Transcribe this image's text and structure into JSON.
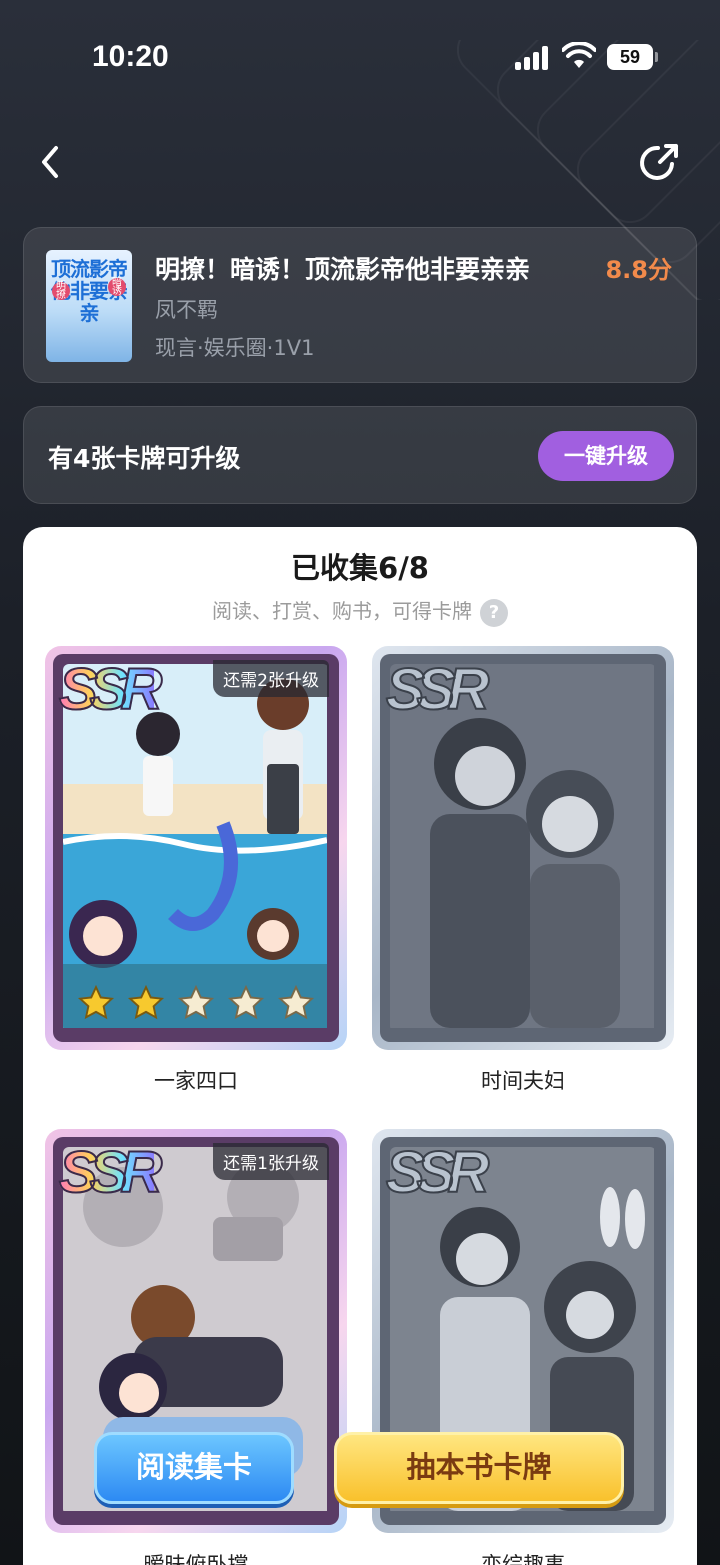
{
  "status_bar": {
    "time": "10:20",
    "battery": "59"
  },
  "nav": {
    "back_icon": "chevron-left-icon",
    "share_icon": "share-icon"
  },
  "book": {
    "title": "明撩！暗诱！顶流影帝他非要亲亲",
    "score": "8.8分",
    "author": "凤不羁",
    "tags": "现言·娱乐圈·1V1",
    "cover": {
      "title": "顶流影帝他非要亲亲",
      "badge_left": "明撩",
      "badge_right": "暗诱"
    }
  },
  "upgrade": {
    "text": "有4张卡牌可升级",
    "button": "一键升级"
  },
  "collection": {
    "title": "已收集6/8",
    "subtitle": "阅读、打赏、购书，可得卡牌",
    "help": "?"
  },
  "cards": [
    {
      "name": "一家四口",
      "rarity": "SSR",
      "need": "还需2张升级",
      "stars": 5,
      "filled_stars": 2,
      "collected": true
    },
    {
      "name": "时间夫妇",
      "rarity": "SSR",
      "need": "",
      "stars": 0,
      "filled_stars": 0,
      "collected": false
    },
    {
      "name": "暧昧俯卧撑",
      "rarity": "SSR",
      "need": "还需1张升级",
      "stars": 5,
      "filled_stars": 1,
      "collected": true
    },
    {
      "name": "恋综趣事",
      "rarity": "SSR",
      "need": "",
      "stars": 0,
      "filled_stars": 0,
      "collected": false
    }
  ],
  "actions": {
    "read": "阅读集卡",
    "draw": "抽本书卡牌"
  }
}
